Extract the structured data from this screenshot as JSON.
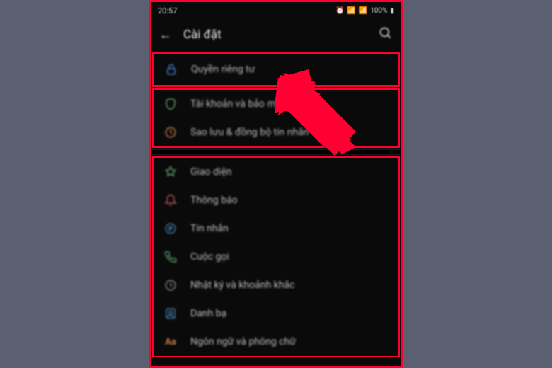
{
  "status_bar": {
    "time": "20:57",
    "battery": "100%"
  },
  "header": {
    "title": "Cài đặt"
  },
  "highlighted_item": {
    "label": "Quyền riêng tư",
    "icon_color": "#4a7bd4"
  },
  "section1": {
    "items": [
      {
        "label": "Tài khoản và bảo mật",
        "icon": "shield",
        "color": "#5a9b6a"
      },
      {
        "label": "Sao lưu & đồng bộ tin nhắn",
        "icon": "history",
        "color": "#c77a4a"
      }
    ]
  },
  "section2": {
    "items": [
      {
        "label": "Giao diện",
        "icon": "paint",
        "color": "#5a9b6a"
      },
      {
        "label": "Thông báo",
        "icon": "bell",
        "color": "#b85a5a"
      },
      {
        "label": "Tin nhắn",
        "icon": "message",
        "color": "#4a7ba8"
      },
      {
        "label": "Cuộc gọi",
        "icon": "phone",
        "color": "#5a9b6a"
      },
      {
        "label": "Nhật ký và khoảnh khắc",
        "icon": "clock",
        "color": "#888"
      },
      {
        "label": "Danh bạ",
        "icon": "contacts",
        "color": "#4a7ba8"
      },
      {
        "label": "Ngôn ngữ và phông chữ",
        "icon": "font",
        "color": "#c77a4a"
      }
    ]
  }
}
